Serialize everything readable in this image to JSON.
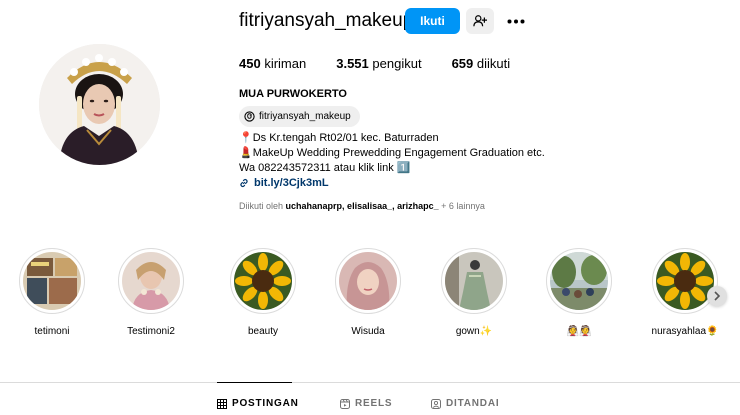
{
  "profile": {
    "username": "fitriyansyah_makeup",
    "follow_label": "Ikuti",
    "stats": {
      "posts_count": "450",
      "posts_label": "kiriman",
      "followers_count": "3.551",
      "followers_label": "pengikut",
      "following_count": "659",
      "following_label": "diikuti"
    }
  },
  "bio": {
    "name": "MUA PURWOKERTO",
    "threads_handle": "fitriyansyah_makeup",
    "lines": [
      "📍Ds Kr.tengah Rt02/01 kec. Baturraden",
      "💄MakeUp Wedding Prewedding Engagement Graduation etc.",
      "Wa 082243572311 atau klik link 1️⃣"
    ],
    "link": "bit.ly/3Cjk3mL",
    "followed_by_prefix": "Diikuti oleh",
    "followed_by_names": "uchahanaprp, elisalisaa_, arizhapc_",
    "followed_by_suffix": "+ 6 lainnya"
  },
  "highlights": [
    {
      "label": "tetimoni",
      "thumb": "photo-collage"
    },
    {
      "label": "Testimoni2",
      "thumb": "bride-portrait"
    },
    {
      "label": "beauty",
      "thumb": "sunflower"
    },
    {
      "label": "Wisuda",
      "thumb": "hijab-portrait"
    },
    {
      "label": "gown✨",
      "thumb": "green-gown"
    },
    {
      "label": "👰👰",
      "thumb": "outdoor-group"
    },
    {
      "label": "nurasyahlaa🌻",
      "thumb": "sunflower"
    }
  ],
  "tabs": [
    {
      "label": "POSTINGAN",
      "icon": "grid-icon",
      "active": true
    },
    {
      "label": "REELS",
      "icon": "reels-icon",
      "active": false
    },
    {
      "label": "DITANDAI",
      "icon": "tagged-icon",
      "active": false
    }
  ],
  "colors": {
    "primary_button": "#0095f6",
    "secondary_button": "#efefef",
    "link": "#00376b",
    "muted_text": "#737373",
    "divider": "#dbdbdb"
  }
}
